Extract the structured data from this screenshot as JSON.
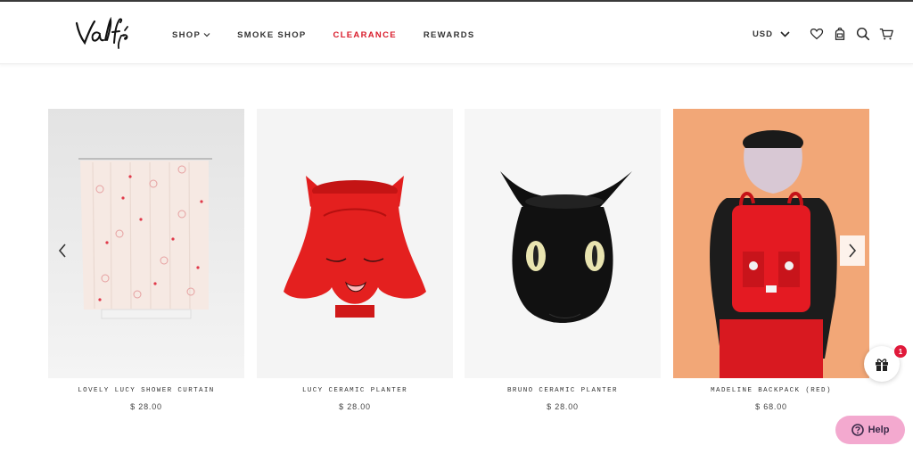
{
  "brand": {
    "logo_text": "Valfré"
  },
  "nav": {
    "items": [
      {
        "label": "SHOP",
        "has_dropdown": true,
        "color": "#333333"
      },
      {
        "label": "SMOKE SHOP",
        "has_dropdown": false,
        "color": "#333333"
      },
      {
        "label": "CLEARANCE",
        "has_dropdown": false,
        "color": "#d91c2b"
      },
      {
        "label": "REWARDS",
        "has_dropdown": false,
        "color": "#333333"
      }
    ]
  },
  "header_right": {
    "currency": "USD",
    "icons": [
      "heart-icon",
      "backpack-icon",
      "search-icon",
      "cart-icon"
    ]
  },
  "products": [
    {
      "name": "LOVELY LUCY SHOWER CURTAIN",
      "price": "$ 28.00"
    },
    {
      "name": "LUCY CERAMIC PLANTER",
      "price": "$ 28.00"
    },
    {
      "name": "BRUNO CERAMIC PLANTER",
      "price": "$ 28.00"
    },
    {
      "name": "MADELINE BACKPACK (RED)",
      "price": "$ 68.00"
    }
  ],
  "gift": {
    "badge_count": "1"
  },
  "help": {
    "label": "Help"
  },
  "colors": {
    "accent_red": "#d91c2b",
    "help_pink": "#f3a9cf",
    "badge_red": "#e0193a"
  }
}
